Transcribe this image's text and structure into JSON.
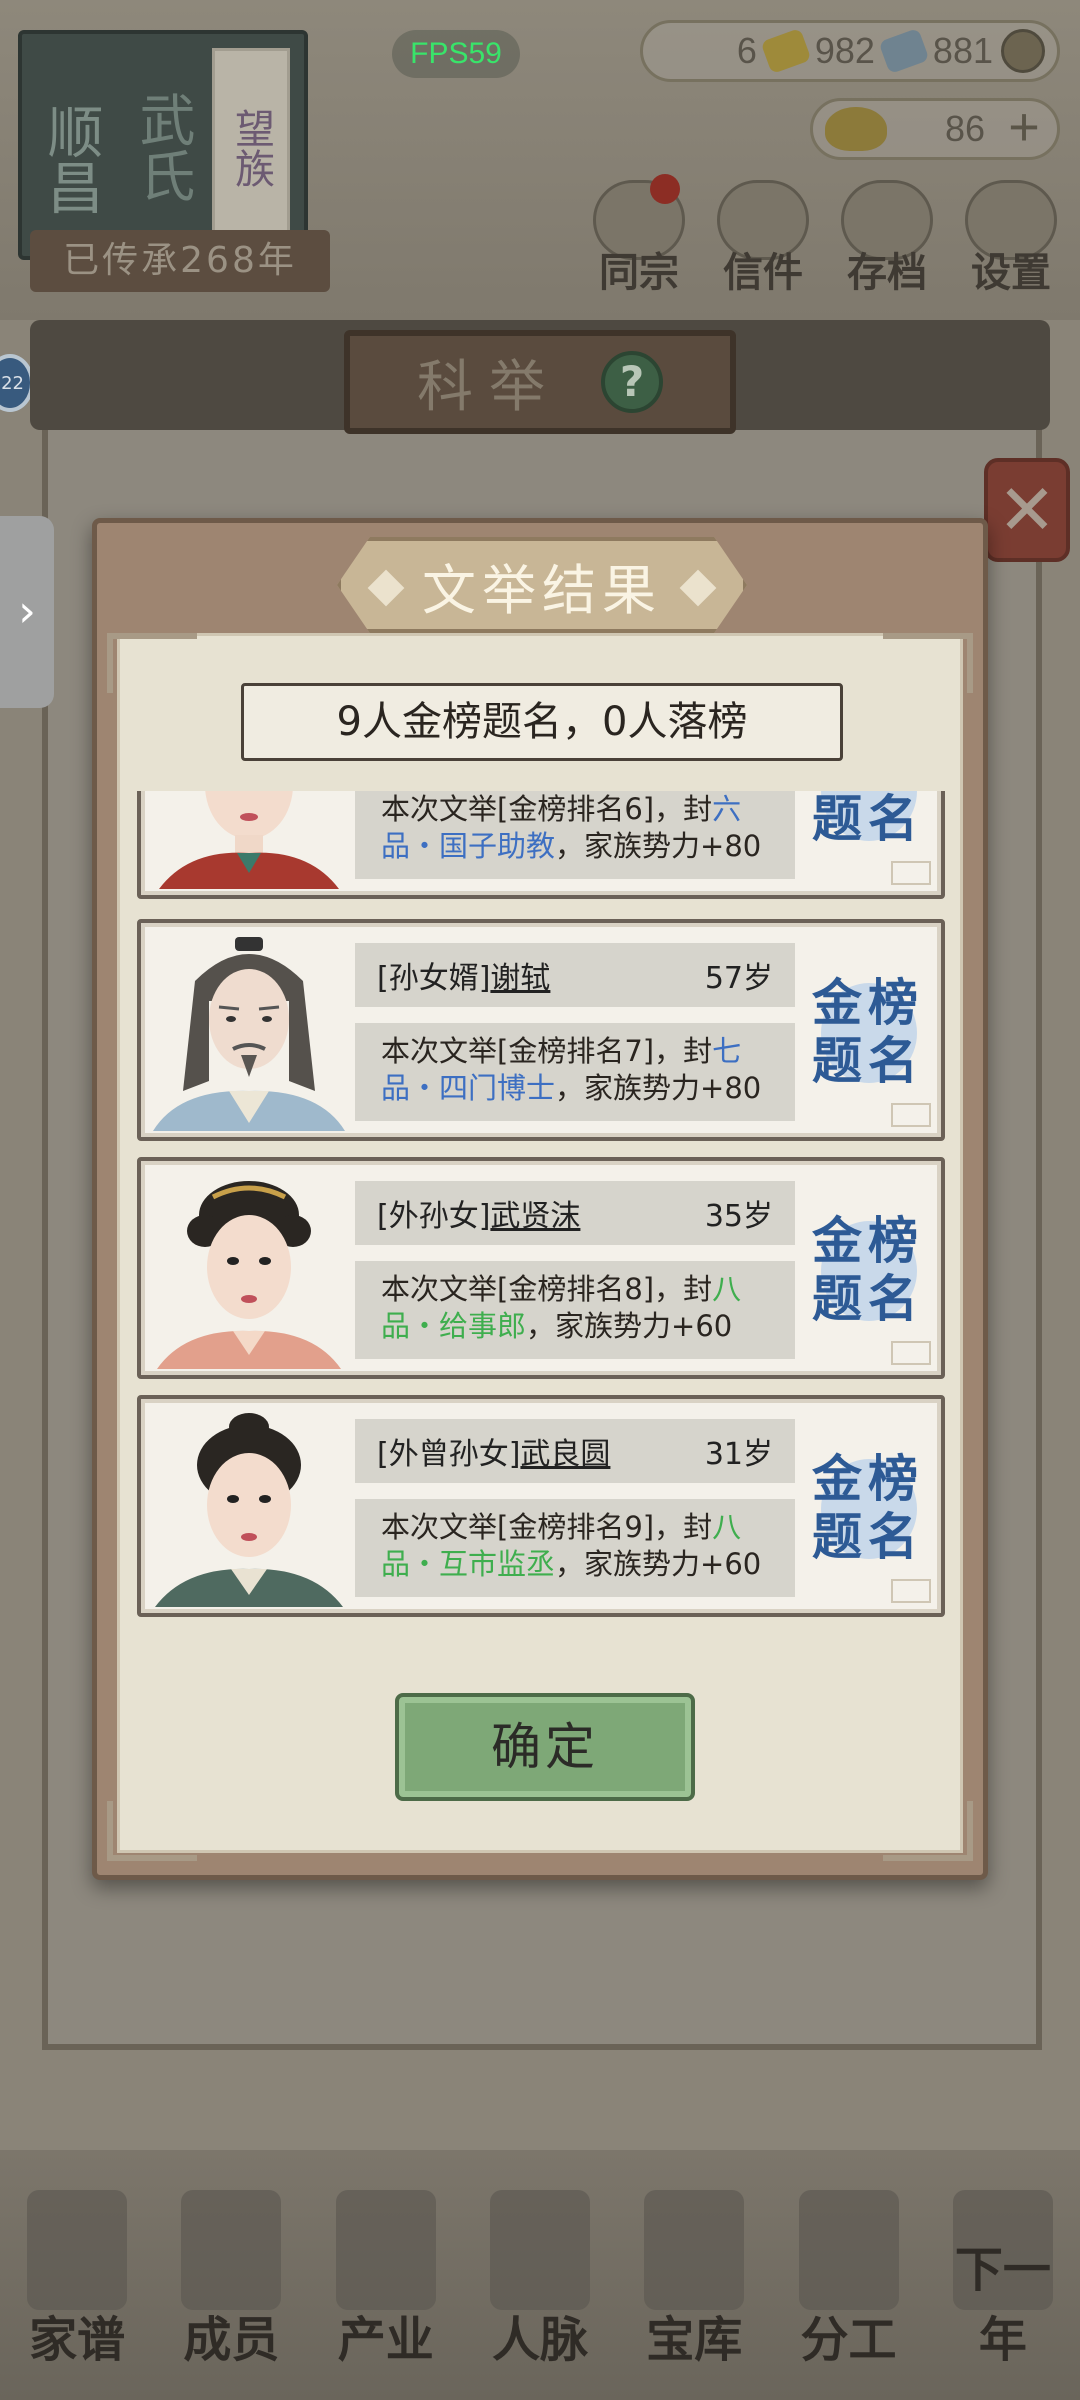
{
  "hud": {
    "fps": "FPS59",
    "resources": {
      "gold": "6",
      "tickets": "982",
      "coins": "881"
    },
    "ingots": "86",
    "clan": {
      "name_left": "顺昌",
      "name_right": "武氏",
      "tag": "望族",
      "years": "已传承268年"
    },
    "menu": [
      {
        "label": "同宗",
        "icon": "clan-icon"
      },
      {
        "label": "信件",
        "icon": "letter-icon"
      },
      {
        "label": "存档",
        "icon": "scroll-icon"
      },
      {
        "label": "设置",
        "icon": "gear-icon"
      }
    ],
    "level": "22"
  },
  "exam_panel": {
    "title": "科举",
    "help": "?",
    "close": "✕"
  },
  "side_tab": {
    "glyph": "›"
  },
  "modal": {
    "title": "文举结果",
    "summary": "9人金榜题名，0人落榜",
    "confirm_label": "确定",
    "stamp_chars": [
      "金",
      "榜",
      "题",
      "名"
    ],
    "results": [
      {
        "relation": "",
        "name": "",
        "age": "",
        "desc_prefix": "本次文举[金榜排名6]，封",
        "rank_title": "六品・国子助教",
        "desc_suffix": "，家族势力+80",
        "rank_color": "blue"
      },
      {
        "relation": "[孙女婿]",
        "name": "谢轼",
        "age": "57岁",
        "desc_prefix": "本次文举[金榜排名7]，封",
        "rank_title": "七品・四门博士",
        "desc_suffix": "，家族势力+80",
        "rank_color": "blue"
      },
      {
        "relation": "[外孙女]",
        "name": "武贤沫",
        "age": "35岁",
        "desc_prefix": "本次文举[金榜排名8]，封",
        "rank_title": "八品・给事郎",
        "desc_suffix": "，家族势力+60",
        "rank_color": "green"
      },
      {
        "relation": "[外曾孙女]",
        "name": "武良圆",
        "age": "31岁",
        "desc_prefix": "本次文举[金榜排名9]，封",
        "rank_title": "八品・互市监丞",
        "desc_suffix": "，家族势力+60",
        "rank_color": "green"
      }
    ]
  },
  "bottom_nav": [
    {
      "label": "家谱",
      "icon": "book-icon"
    },
    {
      "label": "成员",
      "icon": "member-icon"
    },
    {
      "label": "产业",
      "icon": "building-icon"
    },
    {
      "label": "人脉",
      "icon": "network-icon"
    },
    {
      "label": "宝库",
      "icon": "treasure-icon"
    },
    {
      "label": "分工",
      "icon": "task-icon"
    },
    {
      "label": "下一年",
      "icon": "lantern-icon"
    }
  ],
  "colors": {
    "rank_blue": "#3d6fc2",
    "rank_green": "#3fae4e",
    "stamp_blue": "#2d5a95",
    "fps_green": "#39e46a",
    "confirm_green": "#7ea877"
  }
}
